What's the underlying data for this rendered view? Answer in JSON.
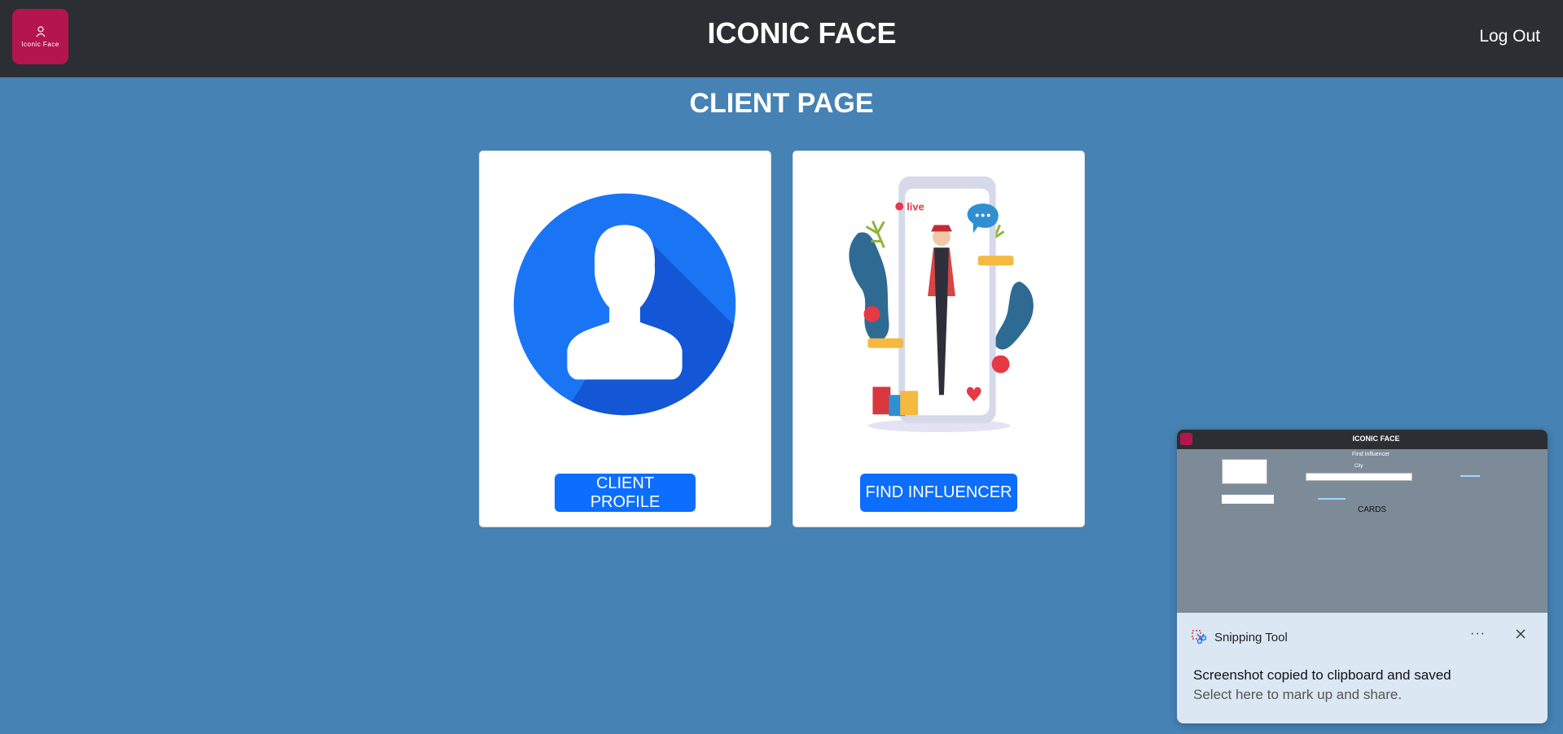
{
  "navbar": {
    "logo_text": "Iconic Face",
    "title": "ICONIC FACE",
    "logout_label": "Log Out"
  },
  "page": {
    "title": "CLIENT PAGE"
  },
  "cards": {
    "client_profile_button": "CLIENT PROFILE",
    "find_influencer_button": "FIND INFLUENCER",
    "live_label": "live"
  },
  "toast": {
    "app_name": "Snipping Tool",
    "more_label": "···",
    "message": "Screenshot copied to clipboard and saved",
    "submessage": "Select here to mark up and share.",
    "preview": {
      "title": "ICONIC FACE",
      "heading": "Find Influencer",
      "city_label": "City",
      "cards_label": "CARDS"
    }
  },
  "colors": {
    "page_bg": "#4682b4",
    "navbar_bg": "#2b2f33",
    "logo_bg": "#b5154f",
    "button_bg": "#0d6efd"
  }
}
